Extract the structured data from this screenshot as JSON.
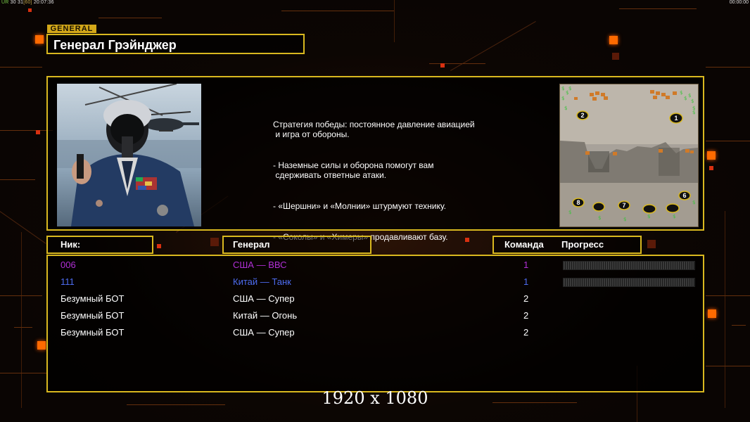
{
  "statusbar": {
    "left_label": "UR",
    "left_a": "30",
    "left_b": "31",
    "left_c": "[60]",
    "left_time": "20:07:36",
    "right_time": "00:00:00"
  },
  "general_tag": "GENERAL",
  "general_name": "Генерал Грэйнджер",
  "description": {
    "line1": "Стратегия победы: постоянное давление авиацией\n и игра от обороны.",
    "line2": "- Наземные силы и оборона помогут вам\n сдерживать ответные атаки.",
    "line3": "- «Шершни» и «Молнии» штурмуют технику.",
    "line4": "- «Соколы» и «Химеры» продавливают базу."
  },
  "minimap": {
    "slots": [
      "2",
      "1",
      "6",
      "8",
      "7"
    ]
  },
  "headers": {
    "nick": "Ник:",
    "general": "Генерал",
    "team": "Команда",
    "progress": "Прогресс"
  },
  "players": [
    {
      "nick": "006",
      "general": "США — ВВС",
      "team": "1",
      "color": "#b12fd6",
      "progress": 0
    },
    {
      "nick": "111",
      "general": "Китай — Танк",
      "team": "1",
      "color": "#4d6cf0",
      "progress": 0
    },
    {
      "nick": "Безумный БОТ",
      "general": "США — Супер",
      "team": "2",
      "color": "#ffffff"
    },
    {
      "nick": "Безумный БОТ",
      "general": "Китай — Огонь",
      "team": "2",
      "color": "#ffffff"
    },
    {
      "nick": "Безумный БОТ",
      "general": "США — Супер",
      "team": "2",
      "color": "#ffffff"
    }
  ],
  "resolution_label": "1920 x 1080",
  "colors": {
    "accent": "#d9b81f",
    "orange": "#ff6a00",
    "background": "#0a0503"
  }
}
